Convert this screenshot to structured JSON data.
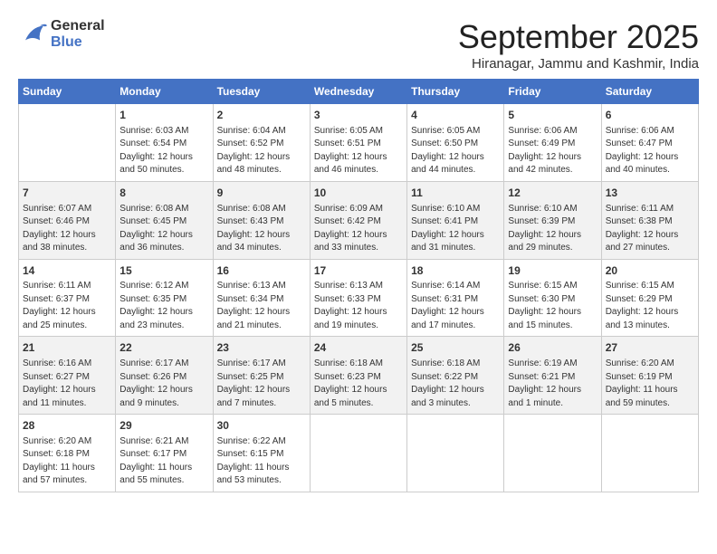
{
  "header": {
    "logo_line1": "General",
    "logo_line2": "Blue",
    "month": "September 2025",
    "location": "Hiranagar, Jammu and Kashmir, India"
  },
  "weekdays": [
    "Sunday",
    "Monday",
    "Tuesday",
    "Wednesday",
    "Thursday",
    "Friday",
    "Saturday"
  ],
  "weeks": [
    [
      {
        "day": "",
        "sunrise": "",
        "sunset": "",
        "daylight": ""
      },
      {
        "day": "1",
        "sunrise": "Sunrise: 6:03 AM",
        "sunset": "Sunset: 6:54 PM",
        "daylight": "Daylight: 12 hours and 50 minutes."
      },
      {
        "day": "2",
        "sunrise": "Sunrise: 6:04 AM",
        "sunset": "Sunset: 6:52 PM",
        "daylight": "Daylight: 12 hours and 48 minutes."
      },
      {
        "day": "3",
        "sunrise": "Sunrise: 6:05 AM",
        "sunset": "Sunset: 6:51 PM",
        "daylight": "Daylight: 12 hours and 46 minutes."
      },
      {
        "day": "4",
        "sunrise": "Sunrise: 6:05 AM",
        "sunset": "Sunset: 6:50 PM",
        "daylight": "Daylight: 12 hours and 44 minutes."
      },
      {
        "day": "5",
        "sunrise": "Sunrise: 6:06 AM",
        "sunset": "Sunset: 6:49 PM",
        "daylight": "Daylight: 12 hours and 42 minutes."
      },
      {
        "day": "6",
        "sunrise": "Sunrise: 6:06 AM",
        "sunset": "Sunset: 6:47 PM",
        "daylight": "Daylight: 12 hours and 40 minutes."
      }
    ],
    [
      {
        "day": "7",
        "sunrise": "Sunrise: 6:07 AM",
        "sunset": "Sunset: 6:46 PM",
        "daylight": "Daylight: 12 hours and 38 minutes."
      },
      {
        "day": "8",
        "sunrise": "Sunrise: 6:08 AM",
        "sunset": "Sunset: 6:45 PM",
        "daylight": "Daylight: 12 hours and 36 minutes."
      },
      {
        "day": "9",
        "sunrise": "Sunrise: 6:08 AM",
        "sunset": "Sunset: 6:43 PM",
        "daylight": "Daylight: 12 hours and 34 minutes."
      },
      {
        "day": "10",
        "sunrise": "Sunrise: 6:09 AM",
        "sunset": "Sunset: 6:42 PM",
        "daylight": "Daylight: 12 hours and 33 minutes."
      },
      {
        "day": "11",
        "sunrise": "Sunrise: 6:10 AM",
        "sunset": "Sunset: 6:41 PM",
        "daylight": "Daylight: 12 hours and 31 minutes."
      },
      {
        "day": "12",
        "sunrise": "Sunrise: 6:10 AM",
        "sunset": "Sunset: 6:39 PM",
        "daylight": "Daylight: 12 hours and 29 minutes."
      },
      {
        "day": "13",
        "sunrise": "Sunrise: 6:11 AM",
        "sunset": "Sunset: 6:38 PM",
        "daylight": "Daylight: 12 hours and 27 minutes."
      }
    ],
    [
      {
        "day": "14",
        "sunrise": "Sunrise: 6:11 AM",
        "sunset": "Sunset: 6:37 PM",
        "daylight": "Daylight: 12 hours and 25 minutes."
      },
      {
        "day": "15",
        "sunrise": "Sunrise: 6:12 AM",
        "sunset": "Sunset: 6:35 PM",
        "daylight": "Daylight: 12 hours and 23 minutes."
      },
      {
        "day": "16",
        "sunrise": "Sunrise: 6:13 AM",
        "sunset": "Sunset: 6:34 PM",
        "daylight": "Daylight: 12 hours and 21 minutes."
      },
      {
        "day": "17",
        "sunrise": "Sunrise: 6:13 AM",
        "sunset": "Sunset: 6:33 PM",
        "daylight": "Daylight: 12 hours and 19 minutes."
      },
      {
        "day": "18",
        "sunrise": "Sunrise: 6:14 AM",
        "sunset": "Sunset: 6:31 PM",
        "daylight": "Daylight: 12 hours and 17 minutes."
      },
      {
        "day": "19",
        "sunrise": "Sunrise: 6:15 AM",
        "sunset": "Sunset: 6:30 PM",
        "daylight": "Daylight: 12 hours and 15 minutes."
      },
      {
        "day": "20",
        "sunrise": "Sunrise: 6:15 AM",
        "sunset": "Sunset: 6:29 PM",
        "daylight": "Daylight: 12 hours and 13 minutes."
      }
    ],
    [
      {
        "day": "21",
        "sunrise": "Sunrise: 6:16 AM",
        "sunset": "Sunset: 6:27 PM",
        "daylight": "Daylight: 12 hours and 11 minutes."
      },
      {
        "day": "22",
        "sunrise": "Sunrise: 6:17 AM",
        "sunset": "Sunset: 6:26 PM",
        "daylight": "Daylight: 12 hours and 9 minutes."
      },
      {
        "day": "23",
        "sunrise": "Sunrise: 6:17 AM",
        "sunset": "Sunset: 6:25 PM",
        "daylight": "Daylight: 12 hours and 7 minutes."
      },
      {
        "day": "24",
        "sunrise": "Sunrise: 6:18 AM",
        "sunset": "Sunset: 6:23 PM",
        "daylight": "Daylight: 12 hours and 5 minutes."
      },
      {
        "day": "25",
        "sunrise": "Sunrise: 6:18 AM",
        "sunset": "Sunset: 6:22 PM",
        "daylight": "Daylight: 12 hours and 3 minutes."
      },
      {
        "day": "26",
        "sunrise": "Sunrise: 6:19 AM",
        "sunset": "Sunset: 6:21 PM",
        "daylight": "Daylight: 12 hours and 1 minute."
      },
      {
        "day": "27",
        "sunrise": "Sunrise: 6:20 AM",
        "sunset": "Sunset: 6:19 PM",
        "daylight": "Daylight: 11 hours and 59 minutes."
      }
    ],
    [
      {
        "day": "28",
        "sunrise": "Sunrise: 6:20 AM",
        "sunset": "Sunset: 6:18 PM",
        "daylight": "Daylight: 11 hours and 57 minutes."
      },
      {
        "day": "29",
        "sunrise": "Sunrise: 6:21 AM",
        "sunset": "Sunset: 6:17 PM",
        "daylight": "Daylight: 11 hours and 55 minutes."
      },
      {
        "day": "30",
        "sunrise": "Sunrise: 6:22 AM",
        "sunset": "Sunset: 6:15 PM",
        "daylight": "Daylight: 11 hours and 53 minutes."
      },
      {
        "day": "",
        "sunrise": "",
        "sunset": "",
        "daylight": ""
      },
      {
        "day": "",
        "sunrise": "",
        "sunset": "",
        "daylight": ""
      },
      {
        "day": "",
        "sunrise": "",
        "sunset": "",
        "daylight": ""
      },
      {
        "day": "",
        "sunrise": "",
        "sunset": "",
        "daylight": ""
      }
    ]
  ]
}
